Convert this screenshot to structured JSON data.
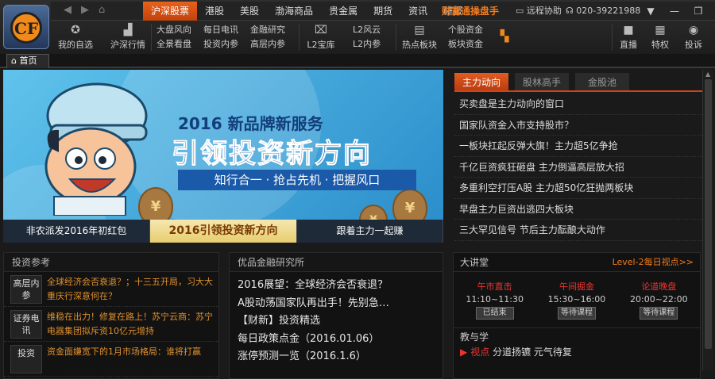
{
  "window": {
    "title": "财富通操盘手"
  },
  "logo": {
    "letters": "CF"
  },
  "nav": {
    "arrows": [
      "back",
      "forward",
      "home"
    ],
    "tabs": [
      "沪深股票",
      "港股",
      "美股",
      "渤海商品",
      "贵金属",
      "期货",
      "资讯",
      "研报"
    ],
    "active_tab": 0,
    "promo": "财富通操盘手",
    "remote": "远程协助",
    "phone": "020-39221988",
    "window_buttons": [
      "menu",
      "minimize",
      "restore",
      "close"
    ]
  },
  "toolbar": {
    "my_picks": "我的自选",
    "hs_market": "沪深行情",
    "pairs": [
      {
        "a": "大盘风向",
        "b": "全景看盘"
      },
      {
        "a": "每日电讯",
        "b": "投资内参"
      },
      {
        "a": "金融研究",
        "b": "高层内参"
      }
    ],
    "l2_bank": "L2宝库",
    "l2pair": {
      "a": "L2风云",
      "b": "L2内参"
    },
    "hot_sector": "热点板块",
    "stockpair": {
      "a": "个股资金",
      "b": "板块资金"
    },
    "live": "直播",
    "privilege": "特权",
    "complaint": "投诉"
  },
  "page_tabs": {
    "home": "首页"
  },
  "banner": {
    "year_line": "2016 新品牌新服务",
    "headline": "引领投资新方向",
    "slogan": "知行合一 · 抢占先机 · 把握风口",
    "strip": [
      "非农派发2016年初红包",
      "2016引领投资新方向",
      "跟着主力一起赚"
    ],
    "strip_active": 1,
    "bag_symbol": "¥"
  },
  "right_panel": {
    "tabs": [
      "主力动向",
      "股林高手",
      "金股池"
    ],
    "active": 0,
    "items": [
      "买卖盘是主力动向的窗口",
      "国家队资金入市支持股市？",
      "一板块扛起反弹大旗！主力超5亿争抢",
      "千亿巨资疯狂砸盘 主力倒逼高层放大招",
      "多重利空打压A股 主力超50亿狂抛两板块",
      "早盘主力巨资出逃四大板块",
      "三大罕见信号 节后主力酝酿大动作"
    ]
  },
  "invest_ref": {
    "title": "投资参考",
    "rows": [
      {
        "tag": "高层内参",
        "text": "全球经济会否衰退？；十三五开局，习大大重庆行深意何在？"
      },
      {
        "tag": "证券电讯",
        "text": "维稳在出力！修复在路上！苏宁云商：苏宁电器集团拟斥资10亿元增持"
      },
      {
        "tag": "投资",
        "text": "资金面嫌宽下的1月市场格局：谁将打赢"
      }
    ]
  },
  "research": {
    "title": "优品金融研究所",
    "items": [
      "2016展望：全球经济会否衰退？",
      "A股动荡国家队再出手！先别急…",
      "【财新】投资精选",
      "每日政策点金（2016.01.06）",
      "涨停预测一览（2016.1.6）"
    ]
  },
  "lecture": {
    "title": "大讲堂",
    "link": "Level-2每日视点>>",
    "sessions": [
      {
        "name": "午市直击",
        "time": "11:10~11:30",
        "status": "已结束"
      },
      {
        "name": "午间掘金",
        "time": "15:30~16:00",
        "status": "等待课程"
      },
      {
        "name": "论道晚盘",
        "time": "20:00~22:00",
        "status": "等待课程"
      }
    ],
    "teach_title": "教与学",
    "teach_item": {
      "tag": "视点",
      "text": "分道扬镳 元气待复"
    }
  }
}
